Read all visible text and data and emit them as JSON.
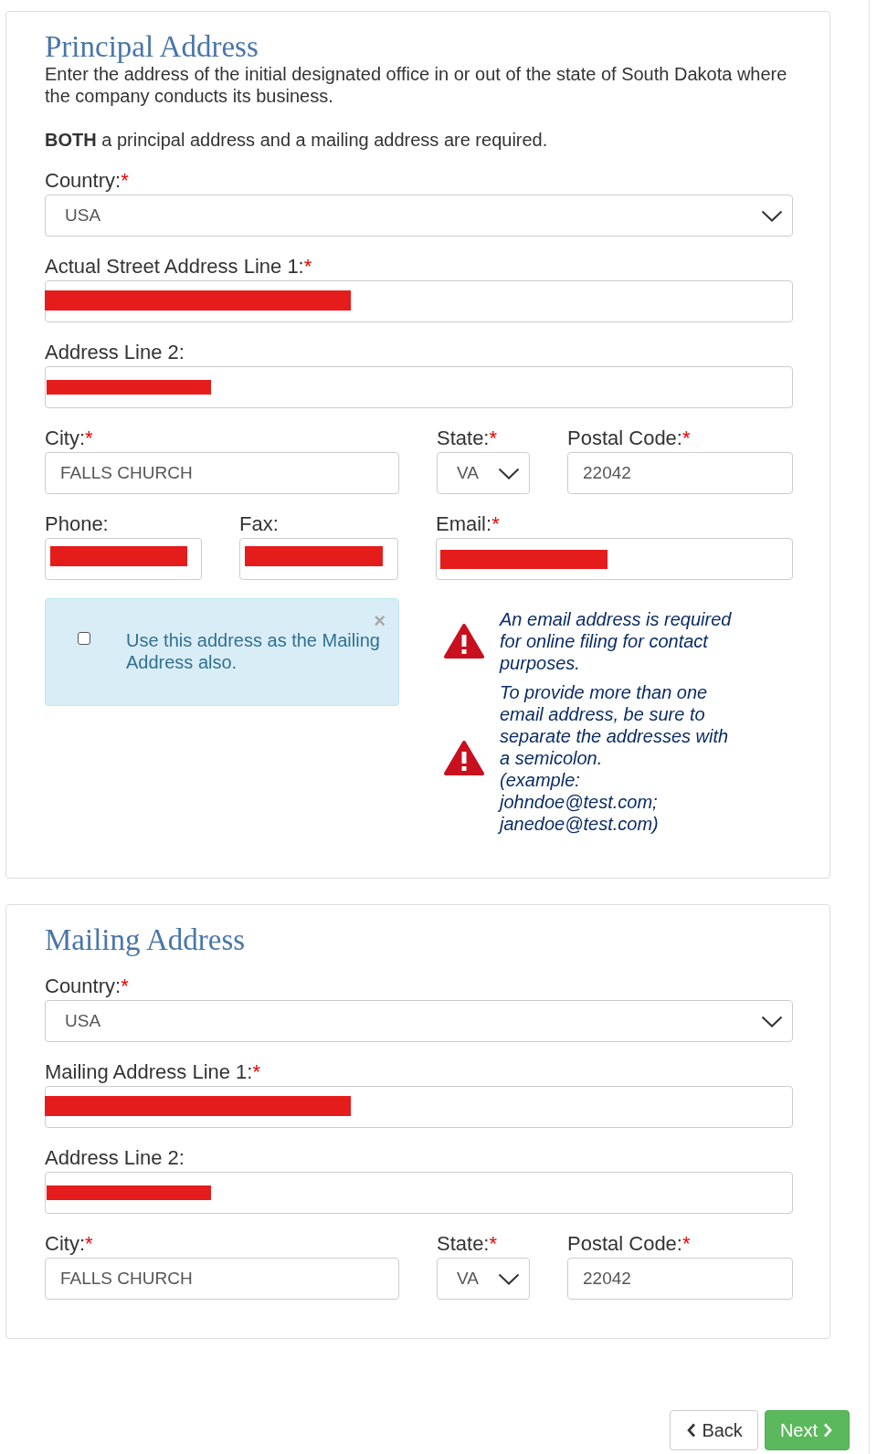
{
  "sections": [
    {
      "title": "Principal Address",
      "intro": [
        "Enter the address of the initial designated office in or out of the state of South Dakota where the company conducts its business.",
        "**BOTH** a principal address and a mailing address are required."
      ],
      "rows": [
        {
          "kind": "single",
          "fields": [
            {
              "kind": "select",
              "label": "Country:",
              "required_mark": "*",
              "value": "USA",
              "redacted": false
            }
          ]
        },
        {
          "kind": "single",
          "fields": [
            {
              "kind": "input",
              "label": "Actual Street Address Line 1:",
              "required_mark": "*",
              "redacted": true
            }
          ]
        },
        {
          "kind": "single",
          "fields": [
            {
              "kind": "input",
              "label": "Address Line 2:",
              "redacted": true
            }
          ]
        },
        {
          "kind": "city_state_postal",
          "fields": [
            {
              "kind": "input",
              "label": "City:",
              "required_mark": "*",
              "value": "FALLS CHURCH",
              "redacted": false
            },
            {
              "kind": "select",
              "label": "State:",
              "required_mark": "*",
              "value": "VA",
              "redacted": false
            },
            {
              "kind": "input",
              "label": "Postal Code:",
              "required_mark": "*",
              "value": "22042",
              "redacted": false
            }
          ]
        },
        {
          "kind": "contact",
          "fields": [
            {
              "kind": "input",
              "label": "Phone:",
              "redacted": true
            },
            {
              "kind": "input",
              "label": "Fax:",
              "redacted": true
            },
            {
              "kind": "input",
              "label": "Email:",
              "required_mark": "*",
              "redacted": true
            }
          ]
        }
      ],
      "mailing_option": {
        "checked": false,
        "text": "Use this address as the Mailing Address also.",
        "close": "×"
      },
      "email_notes": [
        {
          "text": "An email address is required for online filing for contact purposes."
        },
        {
          "text": "To provide more than one email address, be sure to separate the addresses with a semicolon.",
          "example": "(example: johndoe@test.com; janedoe@test.com)"
        }
      ]
    },
    {
      "title": "Mailing Address",
      "rows": [
        {
          "kind": "single",
          "fields": [
            {
              "kind": "select",
              "label": "Country:",
              "required_mark": "*",
              "value": "USA",
              "redacted": false
            }
          ]
        },
        {
          "kind": "single",
          "fields": [
            {
              "kind": "input",
              "label": "Mailing Address Line 1:",
              "required_mark": "*",
              "redacted": true
            }
          ]
        },
        {
          "kind": "single",
          "fields": [
            {
              "kind": "input",
              "label": "Address Line 2:",
              "redacted": true
            }
          ]
        },
        {
          "kind": "city_state_postal",
          "fields": [
            {
              "kind": "input",
              "label": "City:",
              "required_mark": "*",
              "value": "FALLS CHURCH",
              "redacted": false
            },
            {
              "kind": "select",
              "label": "State:",
              "required_mark": "*",
              "value": "VA",
              "redacted": false
            },
            {
              "kind": "input",
              "label": "Postal Code:",
              "required_mark": "*",
              "value": "22042",
              "redacted": false
            }
          ]
        }
      ]
    }
  ],
  "buttons": [
    {
      "kind": "back",
      "label": "Back"
    },
    {
      "kind": "next",
      "label": "Next"
    }
  ]
}
